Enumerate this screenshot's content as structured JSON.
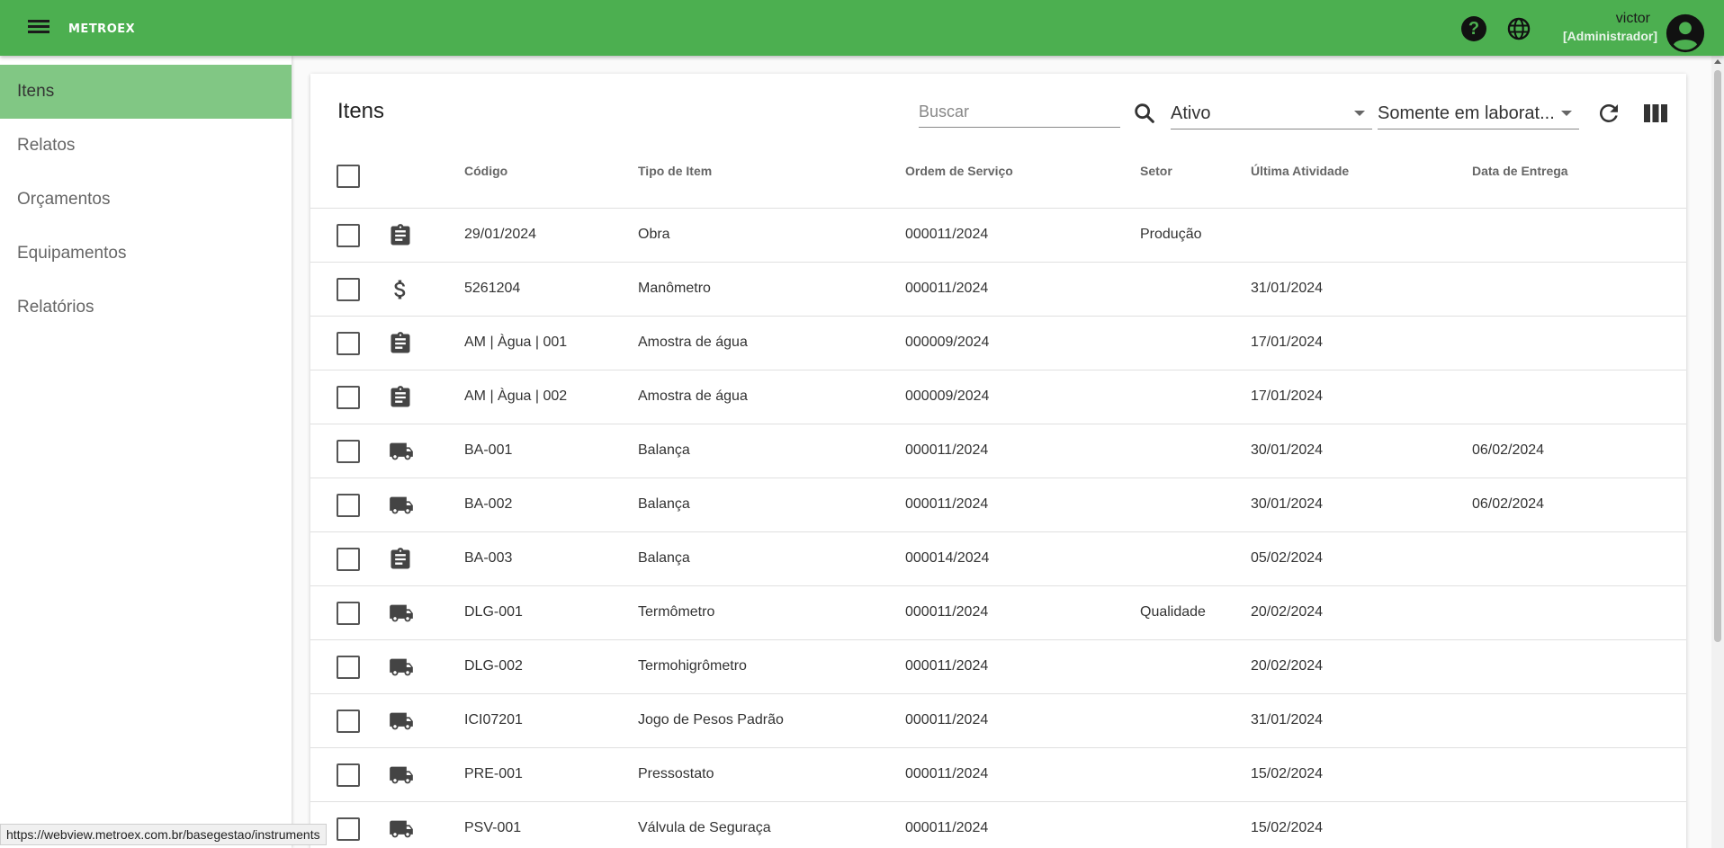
{
  "app": {
    "logo": "METROEX"
  },
  "user": {
    "name": "victor",
    "role": "[Administrador]"
  },
  "sidebar": {
    "items": [
      {
        "label": "Itens",
        "active": true
      },
      {
        "label": "Relatos"
      },
      {
        "label": "Orçamentos"
      },
      {
        "label": "Equipamentos"
      },
      {
        "label": "Relatórios"
      }
    ]
  },
  "main": {
    "title": "Itens",
    "search": {
      "placeholder": "Buscar",
      "value": ""
    },
    "filters": {
      "status": "Ativo",
      "location": "Somente em laborat..."
    },
    "columns": [
      "Código",
      "Tipo de Item",
      "Ordem de Serviço",
      "Setor",
      "Última Atividade",
      "Data de Entrega"
    ],
    "rows": [
      {
        "icon": "clipboard-icon",
        "codigo": "29/01/2024",
        "tipo": "Obra",
        "os": "000011/2024",
        "setor": "Produção",
        "ultima": "",
        "entrega": ""
      },
      {
        "icon": "dollar-icon",
        "codigo": "5261204",
        "tipo": "Manômetro",
        "os": "000011/2024",
        "setor": "",
        "ultima": "31/01/2024",
        "entrega": ""
      },
      {
        "icon": "clipboard-icon",
        "codigo": "AM | Àgua | 001",
        "tipo": "Amostra de água",
        "os": "000009/2024",
        "setor": "",
        "ultima": "17/01/2024",
        "entrega": ""
      },
      {
        "icon": "clipboard-icon",
        "codigo": "AM | Àgua | 002",
        "tipo": "Amostra de água",
        "os": "000009/2024",
        "setor": "",
        "ultima": "17/01/2024",
        "entrega": ""
      },
      {
        "icon": "truck-icon",
        "codigo": "BA-001",
        "tipo": "Balança",
        "os": "000011/2024",
        "setor": "",
        "ultima": "30/01/2024",
        "entrega": "06/02/2024"
      },
      {
        "icon": "truck-icon",
        "codigo": "BA-002",
        "tipo": "Balança",
        "os": "000011/2024",
        "setor": "",
        "ultima": "30/01/2024",
        "entrega": "06/02/2024"
      },
      {
        "icon": "clipboard-icon",
        "codigo": "BA-003",
        "tipo": "Balança",
        "os": "000014/2024",
        "setor": "",
        "ultima": "05/02/2024",
        "entrega": ""
      },
      {
        "icon": "truck-icon",
        "codigo": "DLG-001",
        "tipo": "Termômetro",
        "os": "000011/2024",
        "setor": "Qualidade",
        "ultima": "20/02/2024",
        "entrega": ""
      },
      {
        "icon": "truck-icon",
        "codigo": "DLG-002",
        "tipo": "Termohigrômetro",
        "os": "000011/2024",
        "setor": "",
        "ultima": "20/02/2024",
        "entrega": ""
      },
      {
        "icon": "truck-icon",
        "codigo": "ICI07201",
        "tipo": "Jogo de Pesos Padrão",
        "os": "000011/2024",
        "setor": "",
        "ultima": "31/01/2024",
        "entrega": ""
      },
      {
        "icon": "truck-icon",
        "codigo": "PRE-001",
        "tipo": "Pressostato",
        "os": "000011/2024",
        "setor": "",
        "ultima": "15/02/2024",
        "entrega": ""
      },
      {
        "icon": "truck-icon",
        "codigo": "PSV-001",
        "tipo": "Válvula de Seguraça",
        "os": "000011/2024",
        "setor": "",
        "ultima": "15/02/2024",
        "entrega": ""
      }
    ]
  },
  "status_url": "https://webview.metroex.com.br/basegestao/instruments",
  "colors": {
    "topbar": "#4caf50",
    "sidebar_active": "#81c784"
  }
}
